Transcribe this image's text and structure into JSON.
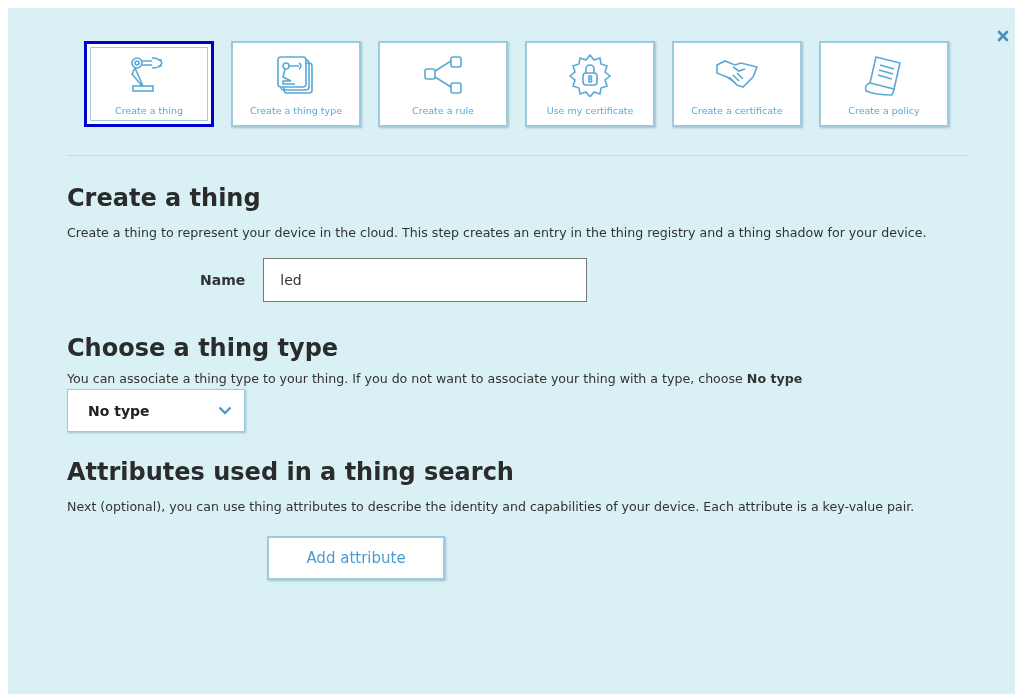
{
  "tiles": [
    {
      "label": "Create a thing",
      "kind": "robot",
      "selected": true
    },
    {
      "label": "Create a thing type",
      "kind": "stack",
      "selected": false
    },
    {
      "label": "Create a rule",
      "kind": "branch",
      "selected": false
    },
    {
      "label": "Use my certificate",
      "kind": "badge",
      "selected": false
    },
    {
      "label": "Create a certificate",
      "kind": "handshake",
      "selected": false
    },
    {
      "label": "Create a policy",
      "kind": "scroll",
      "selected": false
    }
  ],
  "create_thing": {
    "heading": "Create a thing",
    "description": "Create a thing to represent your device in the cloud. This step creates an entry in the thing registry and a thing shadow for your device.",
    "name_label": "Name",
    "name_value": "led"
  },
  "thing_type": {
    "heading": "Choose a thing type",
    "description": "You can associate a thing type to your thing. If you do not want to associate your thing with a type, choose **No type**",
    "select_value": "No type"
  },
  "attributes": {
    "heading": "Attributes used in a thing search",
    "description": "Next (optional), you can use thing attributes to describe the identity and capabilities of your device. Each attribute is a key-value pair.",
    "button": "Add attribute"
  }
}
